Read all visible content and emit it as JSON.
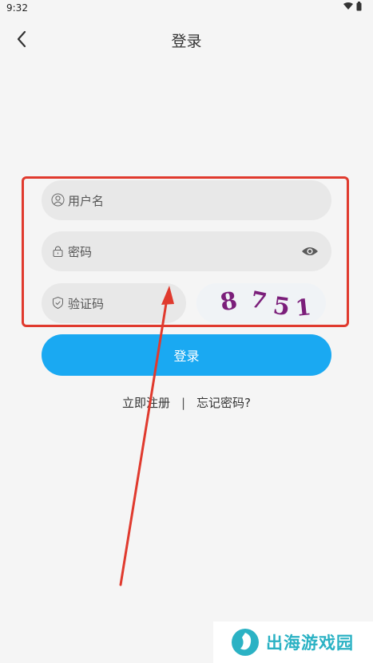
{
  "status_bar": {
    "time": "9:32"
  },
  "header": {
    "title": "登录"
  },
  "form": {
    "username": {
      "placeholder": "用户名"
    },
    "password": {
      "placeholder": "密码"
    },
    "captcha_input": {
      "placeholder": "验证码"
    },
    "captcha_image": {
      "chars": [
        "8",
        "7",
        "5",
        "1"
      ]
    }
  },
  "actions": {
    "login_label": "登录",
    "register_label": "立即注册",
    "separator": "|",
    "forgot_label": "忘记密码?"
  },
  "watermark": {
    "text": "出海游戏园"
  },
  "colors": {
    "accent": "#1aa9f2",
    "highlight": "#e03a2e",
    "captcha": "#7b1e7a"
  },
  "icons": [
    "back-arrow-icon",
    "wifi-icon",
    "battery-icon",
    "user-icon",
    "lock-icon",
    "eye-icon",
    "shield-icon"
  ]
}
